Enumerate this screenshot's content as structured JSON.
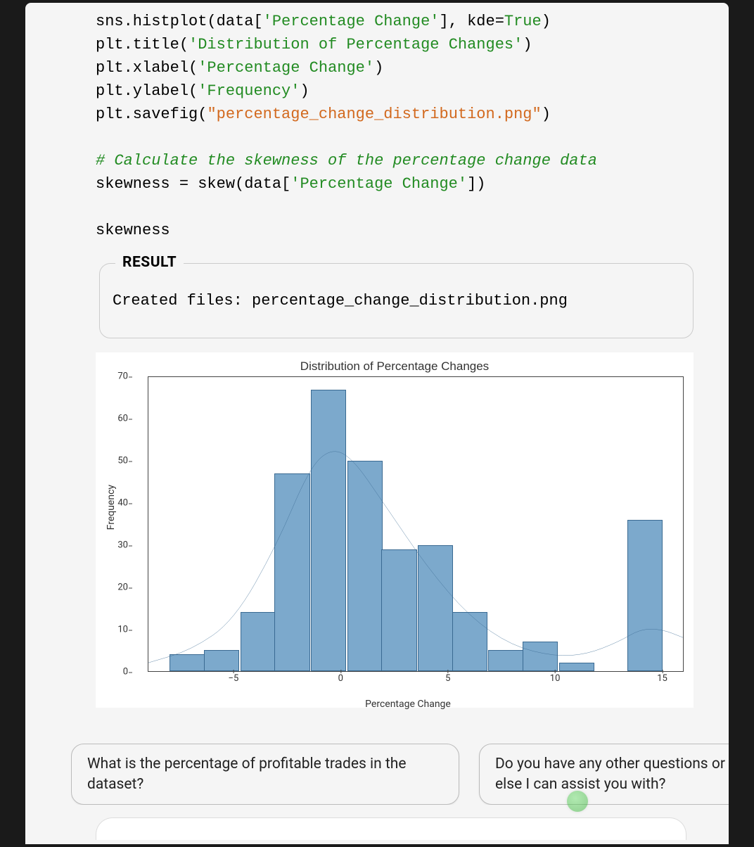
{
  "code": {
    "l1a": "sns.histplot(data[",
    "l1b": "'Percentage Change'",
    "l1c": "], kde=",
    "l1d": "True",
    "l1e": ")",
    "l2a": "plt.title(",
    "l2b": "'Distribution of Percentage Changes'",
    "l2c": ")",
    "l3a": "plt.xlabel(",
    "l3b": "'Percentage Change'",
    "l3c": ")",
    "l4a": "plt.ylabel(",
    "l4b": "'Frequency'",
    "l4c": ")",
    "l5a": "plt.savefig(",
    "l5b": "\"percentage_change_distribution.png\"",
    "l5c": ")",
    "l6a": "# Calculate the skewness of the percentage change data",
    "l7a": "skewness = skew(data[",
    "l7b": "'Percentage Change'",
    "l7c": "])",
    "l8a": "skewness"
  },
  "result": {
    "label": "RESULT",
    "text": "Created files: percentage_change_distribution.png"
  },
  "chart_data": {
    "type": "bar",
    "title": "Distribution of Percentage Changes",
    "xlabel": "Percentage Change",
    "ylabel": "Frequency",
    "ylim": [
      0,
      70
    ],
    "xlim": [
      -9,
      16
    ],
    "y_ticks": [
      0,
      10,
      20,
      30,
      40,
      50,
      60,
      70
    ],
    "x_ticks": [
      -5,
      0,
      5,
      10,
      15
    ],
    "bin_left_edges": [
      -8.0,
      -6.4,
      -4.7,
      -3.1,
      -1.4,
      0.3,
      1.9,
      3.6,
      5.2,
      6.9,
      8.5,
      10.2,
      11.8,
      13.4
    ],
    "bin_width": 1.65,
    "values": [
      4,
      5,
      14,
      47,
      67,
      50,
      29,
      30,
      14,
      5,
      7,
      2,
      0,
      36
    ],
    "kde_points": [
      {
        "x": -9,
        "y": 2
      },
      {
        "x": -7,
        "y": 5
      },
      {
        "x": -5,
        "y": 12
      },
      {
        "x": -3,
        "y": 30
      },
      {
        "x": -1.5,
        "y": 48
      },
      {
        "x": -0.5,
        "y": 53
      },
      {
        "x": 0.5,
        "y": 51
      },
      {
        "x": 2,
        "y": 40
      },
      {
        "x": 4,
        "y": 25
      },
      {
        "x": 6,
        "y": 13
      },
      {
        "x": 8,
        "y": 6
      },
      {
        "x": 10,
        "y": 3.5
      },
      {
        "x": 11.5,
        "y": 4
      },
      {
        "x": 13,
        "y": 7
      },
      {
        "x": 14,
        "y": 10
      },
      {
        "x": 15,
        "y": 10
      },
      {
        "x": 16,
        "y": 8
      }
    ]
  },
  "suggestions": {
    "s1": "What is the percentage of profitable trades in the dataset?",
    "s2": "Do you have any other questions or else I can assist you with?"
  }
}
